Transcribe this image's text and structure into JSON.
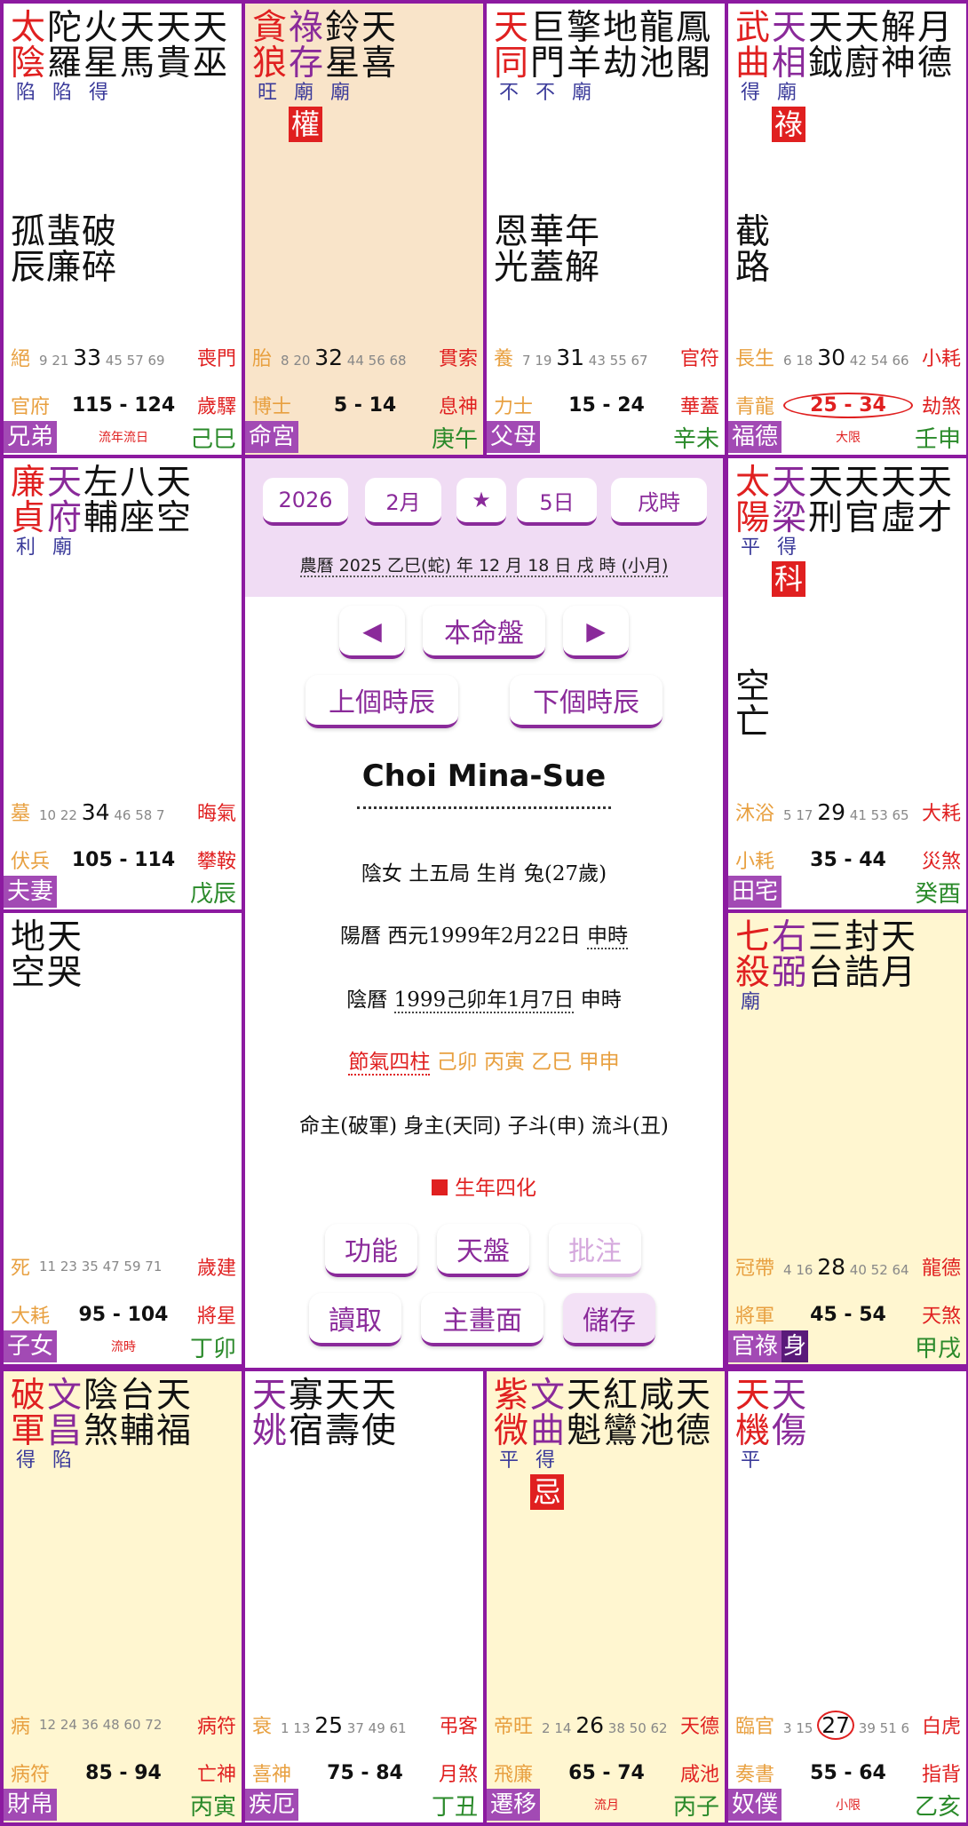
{
  "colors": {
    "red": "#e02020",
    "purple": "#8a2a9a",
    "black": "#111111",
    "brightness": "#3a3a9a",
    "hua_red": "#e02020",
    "cream": "#fff6d0",
    "peach": "#f9e4c9"
  },
  "palaces": [
    {
      "id": "si",
      "bg": "white",
      "major": [
        {
          "c": "太",
          "col": "red"
        },
        {
          "c": "陰",
          "col": "red"
        }
      ],
      "major_br": [
        "陷"
      ],
      "cols": [
        [
          "陀",
          "羅"
        ],
        [
          "火",
          "星"
        ],
        [
          "天",
          "馬"
        ],
        [
          "天",
          "貴"
        ],
        [
          "天",
          "巫"
        ]
      ],
      "col_br": [
        "陷",
        "得",
        "",
        ""
      ],
      "hua": [],
      "minor": [
        [
          "孤",
          "辰"
        ],
        [
          "蜚",
          "廉"
        ],
        [
          "破",
          "碎"
        ]
      ],
      "stage": "絕",
      "ages_pre": "9 21",
      "age": "33",
      "ages_post": "45 57 69",
      "god": "喪門",
      "doc": "官府",
      "decade": "115 - 124",
      "sui": "歲驛",
      "palace": "兄弟",
      "mid": "流年流日",
      "stem": "己巳"
    },
    {
      "id": "wu",
      "bg": "peach",
      "major": [
        {
          "c": "貪",
          "col": "red"
        },
        {
          "c": "狼",
          "col": "red"
        }
      ],
      "major_br": [
        "旺"
      ],
      "cols": [
        [
          "祿",
          "存"
        ],
        [
          "鈴",
          "星"
        ],
        [
          "天",
          "喜"
        ]
      ],
      "col_br": [
        "廟",
        "廟"
      ],
      "hua": [
        "權"
      ],
      "minor": [],
      "stage": "胎",
      "ages_pre": "8 20",
      "age": "32",
      "ages_post": "44 56 68",
      "god": "貫索",
      "doc": "博士",
      "decade": "5 - 14",
      "sui": "息神",
      "palace": "命宮",
      "mid": "",
      "stem": "庚午"
    },
    {
      "id": "wei",
      "bg": "white",
      "major": [
        {
          "c": "天",
          "col": "red"
        },
        {
          "c": "同",
          "col": "red"
        }
      ],
      "major_br": [
        "不"
      ],
      "cols": [
        [
          "巨",
          "門"
        ],
        [
          "擎",
          "羊"
        ],
        [
          "地",
          "劫"
        ],
        [
          "龍",
          "池"
        ],
        [
          "鳳",
          "閣"
        ]
      ],
      "col_br": [
        "不",
        "廟"
      ],
      "hua": [],
      "minor": [
        [
          "恩",
          "光"
        ],
        [
          "華",
          "蓋"
        ],
        [
          "年",
          "解"
        ]
      ],
      "stage": "養",
      "ages_pre": "7 19",
      "age": "31",
      "ages_post": "43 55 67",
      "god": "官符",
      "doc": "力士",
      "decade": "15 - 24",
      "sui": "華蓋",
      "palace": "父母",
      "mid": "",
      "stem": "辛未"
    },
    {
      "id": "shen",
      "bg": "white",
      "major": [
        {
          "c": "武",
          "col": "red"
        },
        {
          "c": "曲",
          "col": "red"
        }
      ],
      "major_br": [
        "得"
      ],
      "cols": [
        [
          "天",
          "相"
        ],
        [
          "天",
          "鉞"
        ],
        [
          "天",
          "廚"
        ],
        [
          "解",
          "神"
        ],
        [
          "月",
          "德"
        ]
      ],
      "col_br": [
        "廟"
      ],
      "hua": [
        "祿"
      ],
      "minor": [
        [
          "截",
          "路"
        ]
      ],
      "stage": "長生",
      "ages_pre": "6 18",
      "age": "30",
      "ages_post": "42 54 66",
      "god": "小耗",
      "doc": "青龍",
      "decade": "25 - 34",
      "sui": "劫煞",
      "palace": "福德",
      "mid": "大限",
      "stem": "壬申"
    },
    {
      "id": "chen",
      "bg": "white",
      "major": [
        {
          "c": "廉",
          "col": "red"
        },
        {
          "c": "貞",
          "col": "red"
        }
      ],
      "major_br": [
        "利"
      ],
      "cols": [
        [
          "天",
          "府"
        ],
        [
          "左",
          "輔"
        ],
        [
          "八",
          "座"
        ],
        [
          "天",
          "空"
        ]
      ],
      "col_br": [
        "廟"
      ],
      "hua": [],
      "minor": [],
      "stage": "墓",
      "ages_pre": "10 22",
      "age": "34",
      "ages_post": "46 58 7",
      "god": "晦氣",
      "doc": "伏兵",
      "decade": "105 - 114",
      "sui": "攀鞍",
      "palace": "夫妻",
      "mid": "",
      "stem": "戊辰"
    },
    {
      "id": "you",
      "bg": "white",
      "major": [
        {
          "c": "太",
          "col": "red"
        },
        {
          "c": "陽",
          "col": "red"
        }
      ],
      "major_br": [
        "平"
      ],
      "cols": [
        [
          "天",
          "梁"
        ],
        [
          "天",
          "刑"
        ],
        [
          "天",
          "官"
        ],
        [
          "天",
          "虛"
        ],
        [
          "天",
          "才"
        ]
      ],
      "col_br": [
        "得"
      ],
      "hua": [
        "科"
      ],
      "minor": [
        [
          "空",
          "亡"
        ]
      ],
      "stage": "沐浴",
      "ages_pre": "5 17",
      "age": "29",
      "ages_post": "41 53 65",
      "god": "大耗",
      "doc": "小耗",
      "decade": "35 - 44",
      "sui": "災煞",
      "palace": "田宅",
      "mid": "",
      "stem": "癸酉"
    },
    {
      "id": "mao",
      "bg": "white",
      "major": [],
      "major_br": [],
      "cols": [
        [
          "地",
          "空"
        ],
        [
          "天",
          "哭"
        ]
      ],
      "col_br": [],
      "hua": [],
      "minor": [],
      "stage": "死",
      "ages_pre": "11 23 35 47 59 71",
      "age": "",
      "ages_post": "",
      "god": "歲建",
      "doc": "大耗",
      "decade": "95 - 104",
      "sui": "將星",
      "palace": "子女",
      "mid": "流時",
      "stem": "丁卯"
    },
    {
      "id": "xu",
      "bg": "cream",
      "major": [
        {
          "c": "七",
          "col": "red"
        },
        {
          "c": "殺",
          "col": "red"
        }
      ],
      "major_br": [
        "廟"
      ],
      "cols": [
        [
          "右",
          "弼"
        ],
        [
          "三",
          "台"
        ],
        [
          "封",
          "誥"
        ],
        [
          "天",
          "月"
        ]
      ],
      "col_br": [],
      "hua": [],
      "minor": [],
      "stage": "冠帶",
      "ages_pre": "4 16",
      "age": "28",
      "ages_post": "40 52 64",
      "god": "龍德",
      "doc": "將軍",
      "decade": "45 - 54",
      "sui": "天煞",
      "palace": "官祿",
      "body": "身",
      "mid": "",
      "stem": "甲戌"
    },
    {
      "id": "yin",
      "bg": "cream",
      "major": [
        {
          "c": "破",
          "col": "red"
        },
        {
          "c": "軍",
          "col": "red"
        }
      ],
      "major_br": [
        "得"
      ],
      "cols": [
        [
          "文",
          "昌"
        ],
        [
          "陰",
          "煞"
        ],
        [
          "台",
          "輔"
        ],
        [
          "天",
          "福"
        ]
      ],
      "col_br": [
        "陷"
      ],
      "hua": [],
      "minor": [],
      "stage": "病",
      "ages_pre": "12 24 36 48 60 72",
      "age": "",
      "ages_post": "",
      "god": "病符",
      "doc": "病符",
      "decade": "85 - 94",
      "sui": "亡神",
      "palace": "財帛",
      "mid": "",
      "stem": "丙寅"
    },
    {
      "id": "chou",
      "bg": "white",
      "major": [],
      "major_br": [],
      "cols": [
        [
          "天",
          "姚"
        ],
        [
          "寡",
          "宿"
        ],
        [
          "天",
          "壽"
        ],
        [
          "天",
          "使"
        ]
      ],
      "col_br": [],
      "hua": [],
      "minor": [],
      "stage": "衰",
      "ages_pre": "1 13",
      "age": "25",
      "ages_post": "37 49 61",
      "god": "弔客",
      "doc": "喜神",
      "decade": "75 - 84",
      "sui": "月煞",
      "palace": "疾厄",
      "mid": "",
      "stem": "丁丑"
    },
    {
      "id": "zi",
      "bg": "cream",
      "major": [
        {
          "c": "紫",
          "col": "red"
        },
        {
          "c": "微",
          "col": "red"
        }
      ],
      "major_br": [
        "平"
      ],
      "cols": [
        [
          "文",
          "曲"
        ],
        [
          "天",
          "魁"
        ],
        [
          "紅",
          "鸞"
        ],
        [
          "咸",
          "池"
        ],
        [
          "天",
          "德"
        ]
      ],
      "col_br": [
        "得"
      ],
      "hua": [
        "忌"
      ],
      "minor": [],
      "stage": "帝旺",
      "ages_pre": "2 14",
      "age": "26",
      "ages_post": "38 50 62",
      "god": "天德",
      "doc": "飛廉",
      "decade": "65 - 74",
      "sui": "咸池",
      "palace": "遷移",
      "mid": "流月",
      "stem": "丙子"
    },
    {
      "id": "hai",
      "bg": "white",
      "major": [
        {
          "c": "天",
          "col": "red"
        },
        {
          "c": "機",
          "col": "red"
        }
      ],
      "major_br": [
        "平"
      ],
      "cols": [
        [
          "天",
          "傷"
        ]
      ],
      "col_br": [],
      "hua": [],
      "minor": [],
      "stage": "臨官",
      "ages_pre": "3 15",
      "age": "27",
      "ages_post": "39 51 6",
      "god": "白虎",
      "doc": "奏書",
      "decade": "55 - 64",
      "sui": "指背",
      "palace": "奴僕",
      "mid": "小限",
      "stem": "乙亥"
    }
  ],
  "center": {
    "year": "2026",
    "month": "2月",
    "star": "★",
    "day": "5日",
    "hour": "戌時",
    "lunar": "農曆 2025 乙巳(蛇) 年 12 月 18 日 戌 時 (小月)",
    "prev": "◀",
    "natal": "本命盤",
    "next": "▶",
    "prev_hour": "上個時辰",
    "next_hour": "下個時辰",
    "name": "Choi Mina-Sue",
    "line1": "陰女  土五局  生肖  兔(27歲)",
    "solar_label": "陽曆  西元1999年2月22日 ",
    "solar_time": "申時",
    "lunar_label": "陰曆 ",
    "lunar_date": "1999己卯年1月7日",
    "lunar_time": " 申時",
    "jieqi_label": "節氣四柱",
    "jieqi": " 己卯  丙寅  乙巳  甲申",
    "line5": "命主(破軍)  身主(天同)  子斗(申)  流斗(丑)",
    "sihua": "生年四化",
    "btn_func": "功能",
    "btn_sky": "天盤",
    "btn_note": "批注",
    "btn_read": "讀取",
    "btn_main": "主畫面",
    "btn_save": "儲存"
  }
}
